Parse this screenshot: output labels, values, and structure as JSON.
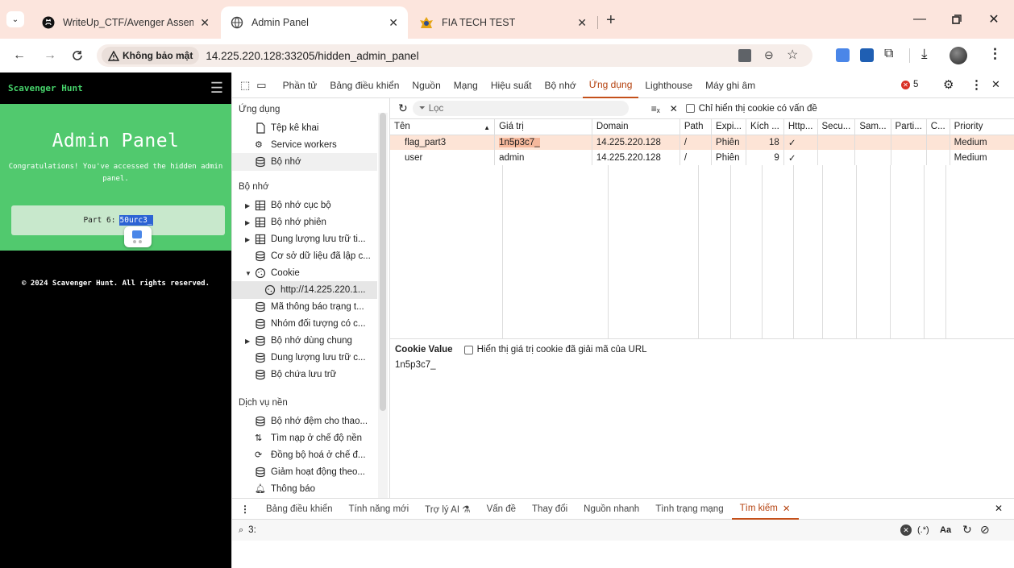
{
  "browser": {
    "tabs": [
      {
        "title": "WriteUp_CTF/Avenger Assembly",
        "close": "✕"
      },
      {
        "title": "Admin Panel",
        "close": "✕"
      },
      {
        "title": "FIA TECH TEST",
        "close": "✕"
      }
    ],
    "new_tab": "+",
    "security_label": "Không bảo mật",
    "url": "14.225.220.128:33205/hidden_admin_panel"
  },
  "page": {
    "brand": "Scavenger Hunt",
    "title": "Admin Panel",
    "message": "Congratulations! You've accessed the hidden admin panel.",
    "part_label": "Part 6:",
    "part_value": "50urc3_",
    "footer": "© 2024 Scavenger Hunt. All rights reserved."
  },
  "devtools": {
    "tabs": [
      "Phần tử",
      "Bảng điều khiển",
      "Nguồn",
      "Mạng",
      "Hiệu suất",
      "Bộ nhớ",
      "Ứng dụng",
      "Lighthouse",
      "Máy ghi âm"
    ],
    "active_tab": "Ứng dụng",
    "error_count": "5",
    "tree": {
      "section_app": "Ứng dụng",
      "app_items": [
        "Tệp kê khai",
        "Service workers",
        "Bộ nhớ"
      ],
      "section_storage": "Bộ nhớ",
      "storage_items": [
        "Bộ nhớ cục bộ",
        "Bộ nhớ phiên",
        "Dung lượng lưu trữ ti...",
        "Cơ sở dữ liệu đã lập c...",
        "Cookie",
        "http://14.225.220.1...",
        "Mã thông báo trạng t...",
        "Nhóm đối tượng có c...",
        "Bộ nhớ dùng chung",
        "Dung lượng lưu trữ c...",
        "Bộ chứa lưu trữ"
      ],
      "section_bg": "Dịch vụ nền",
      "bg_items": [
        "Bộ nhớ đệm cho thao...",
        "Tìm nạp ở chế độ nền",
        "Đồng bộ hoá ở chế đ...",
        "Giảm hoạt động theo...",
        "Thông báo"
      ]
    },
    "filter_placeholder": "Lọc",
    "only_issues_label": "Chỉ hiển thị cookie có vấn đề",
    "columns": [
      "Tên",
      "Giá trị",
      "Domain",
      "Path",
      "Expi...",
      "Kích ...",
      "Http...",
      "Secu...",
      "Sam...",
      "Parti...",
      "C...",
      "Priority"
    ],
    "rows": [
      {
        "name": "flag_part3",
        "value": "1n5p3c7_",
        "domain": "14.225.220.128",
        "path": "/",
        "expires": "Phiên",
        "size": "18",
        "http": "✓",
        "priority": "Medium"
      },
      {
        "name": "user",
        "value": "admin",
        "domain": "14.225.220.128",
        "path": "/",
        "expires": "Phiên",
        "size": "9",
        "http": "✓",
        "priority": "Medium"
      }
    ],
    "cookie_value_label": "Cookie Value",
    "decode_label": "Hiển thị giá trị cookie đã giải mã của URL",
    "cookie_value": "1n5p3c7_",
    "drawer_tabs": [
      "Bảng điều khiển",
      "Tính năng mới",
      "Trợ lý AI",
      "Vấn đề",
      "Thay đổi",
      "Nguồn nhanh",
      "Tình trạng mạng",
      "Tìm kiếm"
    ],
    "search_query": "3:",
    "regex_label": "(.*)",
    "case_label": "Aa"
  }
}
